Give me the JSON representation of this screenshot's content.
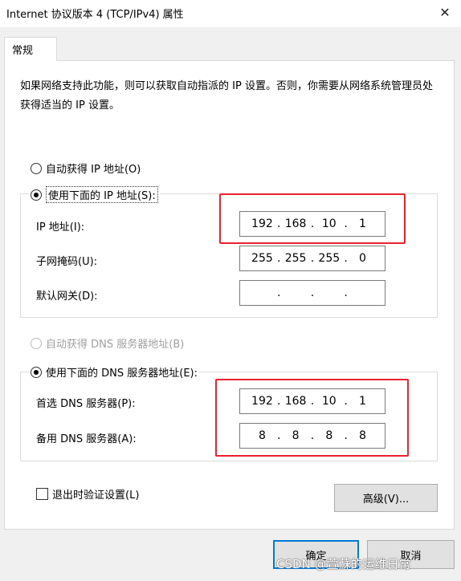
{
  "window": {
    "title": "Internet 协议版本 4 (TCP/IPv4) 属性",
    "close_glyph": "✕"
  },
  "tabs": [
    {
      "label": "常规",
      "active": true
    }
  ],
  "description": "如果网络支持此功能，则可以获取自动指派的 IP 设置。否则，你需要从网络系统管理员处获得适当的 IP 设置。",
  "ip_section": {
    "auto_option": {
      "label": "自动获得 IP 地址(O)",
      "checked": false
    },
    "manual_option": {
      "label": "使用下面的 IP 地址(S):",
      "checked": true
    },
    "fields": [
      {
        "label": "IP 地址(I):",
        "octets": [
          "192",
          "168",
          "10",
          "1"
        ]
      },
      {
        "label": "子网掩码(U):",
        "octets": [
          "255",
          "255",
          "255",
          "0"
        ]
      },
      {
        "label": "默认网关(D):",
        "octets": [
          "",
          "",
          "",
          ""
        ]
      }
    ]
  },
  "dns_section": {
    "auto_option": {
      "label": "自动获得 DNS 服务器地址(B)",
      "checked": false,
      "disabled": true
    },
    "manual_option": {
      "label": "使用下面的 DNS 服务器地址(E):",
      "checked": true
    },
    "fields": [
      {
        "label": "首选 DNS 服务器(P):",
        "octets": [
          "192",
          "168",
          "10",
          "1"
        ]
      },
      {
        "label": "备用 DNS 服务器(A):",
        "octets": [
          "8",
          "8",
          "8",
          "8"
        ]
      }
    ]
  },
  "validate_on_exit": {
    "label": "退出时验证设置(L)",
    "checked": false
  },
  "buttons": {
    "advanced": "高级(V)...",
    "ok": "确定",
    "cancel": "取消"
  },
  "watermark": "CSDN @萱蘇的运维日常",
  "colors": {
    "highlight": "#e8222e",
    "focus_blue": "#0078d7",
    "dialog_bg": "#f0f0f0"
  }
}
